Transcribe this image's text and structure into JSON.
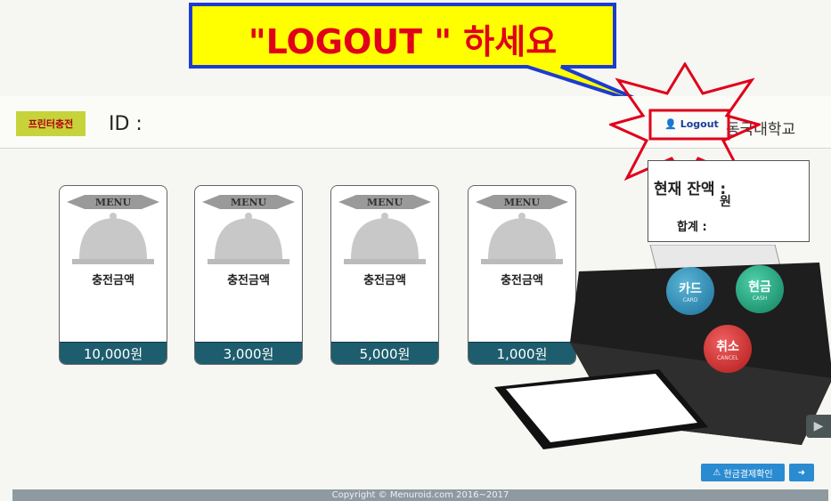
{
  "callout": {
    "text": "\"LOGOUT \" 하세요"
  },
  "header": {
    "brand": "프린터충전",
    "id_label": "ID :",
    "logout_label": "Logout",
    "school": "동국대학교"
  },
  "balance": {
    "current_label": "현재 잔액 :",
    "won": "원",
    "total_label": "합계 :"
  },
  "menu_cards": [
    {
      "menu": "MENU",
      "label": "충전금액",
      "price": "10,000원"
    },
    {
      "menu": "MENU",
      "label": "충전금액",
      "price": "3,000원"
    },
    {
      "menu": "MENU",
      "label": "충전금액",
      "price": "5,000원"
    },
    {
      "menu": "MENU",
      "label": "충전금액",
      "price": "1,000원"
    }
  ],
  "payment": {
    "card_label": "카드",
    "card_sub": "CARD",
    "cash_label": "현금",
    "cash_sub": "CASH",
    "cancel_label": "취소",
    "cancel_sub": "CANCEL"
  },
  "bottom": {
    "history_label": "현금결제확인",
    "footer": "Copyright © Menuroid.com 2016~2017"
  },
  "colors": {
    "callout_bg": "#ffff00",
    "callout_border": "#1c3cd0",
    "highlight_red": "#e0001a",
    "price_band": "#1d5d6d"
  }
}
